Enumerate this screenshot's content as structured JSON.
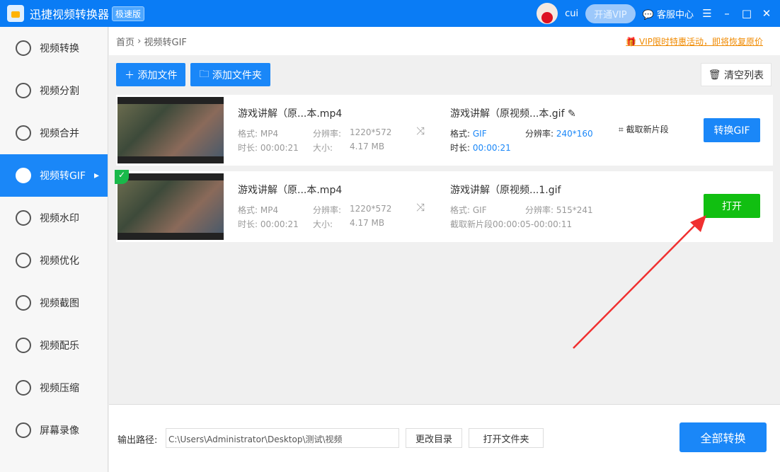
{
  "app": {
    "title": "迅捷视频转换器",
    "edition": "极速版",
    "user": "cui",
    "vip": "开通VIP",
    "service": "客服中心"
  },
  "sidebar": [
    "视频转换",
    "视频分割",
    "视频合并",
    "视频转GIF",
    "视频水印",
    "视频优化",
    "视频截图",
    "视频配乐",
    "视频压缩",
    "屏幕录像"
  ],
  "breadcrumb": {
    "home": "首页",
    "sep": "›",
    "current": "视频转GIF"
  },
  "promo": "VIP限时特惠活动，即将恢复原价",
  "toolbar": {
    "add_file": "添加文件",
    "add_folder": "添加文件夹",
    "clear": "清空列表"
  },
  "labels": {
    "format": "格式:",
    "res": "分辨率:",
    "dur": "时长:",
    "size": "大小:"
  },
  "rows": [
    {
      "src": "游戏讲解（原...本.mp4",
      "sfmt": "MP4",
      "sres": "1220*572",
      "sdur": "00:00:21",
      "ssize": "4.17 MB",
      "out": "游戏讲解（原视频...本.gif",
      "ofmt": "GIF",
      "ores": "240*160",
      "odur": "00:00:21",
      "clip": "截取新片段",
      "btn": "转换GIF"
    },
    {
      "src": "游戏讲解（原...本.mp4",
      "sfmt": "MP4",
      "sres": "1220*572",
      "sdur": "00:00:21",
      "ssize": "4.17 MB",
      "out": "游戏讲解（原视频...1.gif",
      "ofmt": "GIF",
      "ores": "515*241",
      "segment": "截取新片段00:00:05-00:00:11",
      "btn": "打开"
    }
  ],
  "bottom": {
    "label": "输出路径:",
    "path": "C:\\Users\\Administrator\\Desktop\\测试\\视频",
    "change": "更改目录",
    "open": "打开文件夹",
    "convert_all": "全部转换"
  }
}
